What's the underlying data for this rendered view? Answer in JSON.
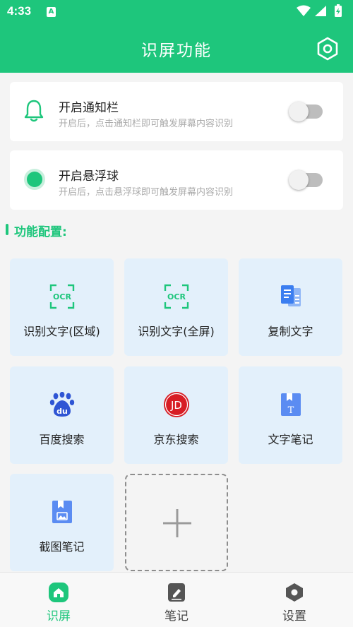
{
  "status_bar": {
    "time": "4:33",
    "notif_glyph": "A"
  },
  "header": {
    "title": "识屏功能",
    "settings_icon": "hexagon-settings-icon"
  },
  "cards": [
    {
      "title": "开启通知栏",
      "subtitle": "开启后，点击通知栏即可触发屏幕内容识别",
      "toggle_on": false,
      "icon": "bell-icon"
    },
    {
      "title": "开启悬浮球",
      "subtitle": "开启后，点击悬浮球即可触发屏幕内容识别",
      "toggle_on": false,
      "icon": "floating-ball-icon"
    }
  ],
  "section": {
    "label": "功能配置:"
  },
  "tiles": [
    {
      "label": "识别文字(区域)",
      "icon": "ocr-icon",
      "ocr_text": "OCR"
    },
    {
      "label": "识别文字(全屏)",
      "icon": "ocr-icon",
      "ocr_text": "OCR"
    },
    {
      "label": "复制文字",
      "icon": "copy-text-icon"
    },
    {
      "label": "百度搜索",
      "icon": "baidu-icon",
      "logo_text": "du"
    },
    {
      "label": "京东搜索",
      "icon": "jd-icon",
      "logo_text": "JD"
    },
    {
      "label": "文字笔记",
      "icon": "text-note-icon",
      "logo_text": "T"
    },
    {
      "label": "截图笔记",
      "icon": "screenshot-note-icon"
    }
  ],
  "add_tile": {
    "icon": "plus-icon"
  },
  "nav": [
    {
      "label": "识屏",
      "icon": "home-icon",
      "active": true
    },
    {
      "label": "笔记",
      "icon": "note-icon",
      "active": false
    },
    {
      "label": "设置",
      "icon": "settings-hex-icon",
      "active": false
    }
  ],
  "colors": {
    "accent": "#1ec67c",
    "tile_bg": "#e3f0fb",
    "icon_blue": "#3b7ef0",
    "jd_red": "#d71d24"
  }
}
